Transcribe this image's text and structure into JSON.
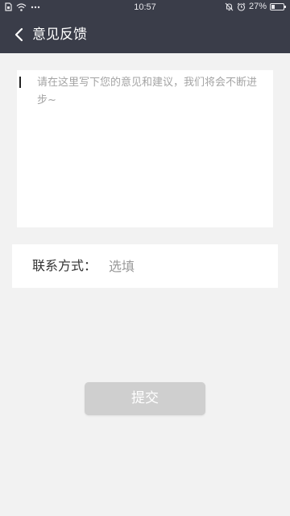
{
  "status_bar": {
    "time": "10:57",
    "battery": "27%",
    "battery_level": 0.27,
    "icons": [
      "sim-card-icon",
      "wifi-icon",
      "more-dots-icon",
      "mute-bell-icon",
      "alarm-icon",
      "battery-icon"
    ]
  },
  "app_bar": {
    "title": "意见反馈",
    "back_icon": "chevron-left-icon"
  },
  "feedback": {
    "value": "",
    "placeholder": "请在这里写下您的意见和建议，我们将会不断进步~"
  },
  "contact": {
    "label": "联系方式：",
    "value": "",
    "placeholder": "选填"
  },
  "submit": {
    "label": "提交"
  },
  "colors": {
    "header_bg": "#3a3d49",
    "page_bg": "#f2f2f2",
    "button_disabled_bg": "#cfcfcf"
  }
}
